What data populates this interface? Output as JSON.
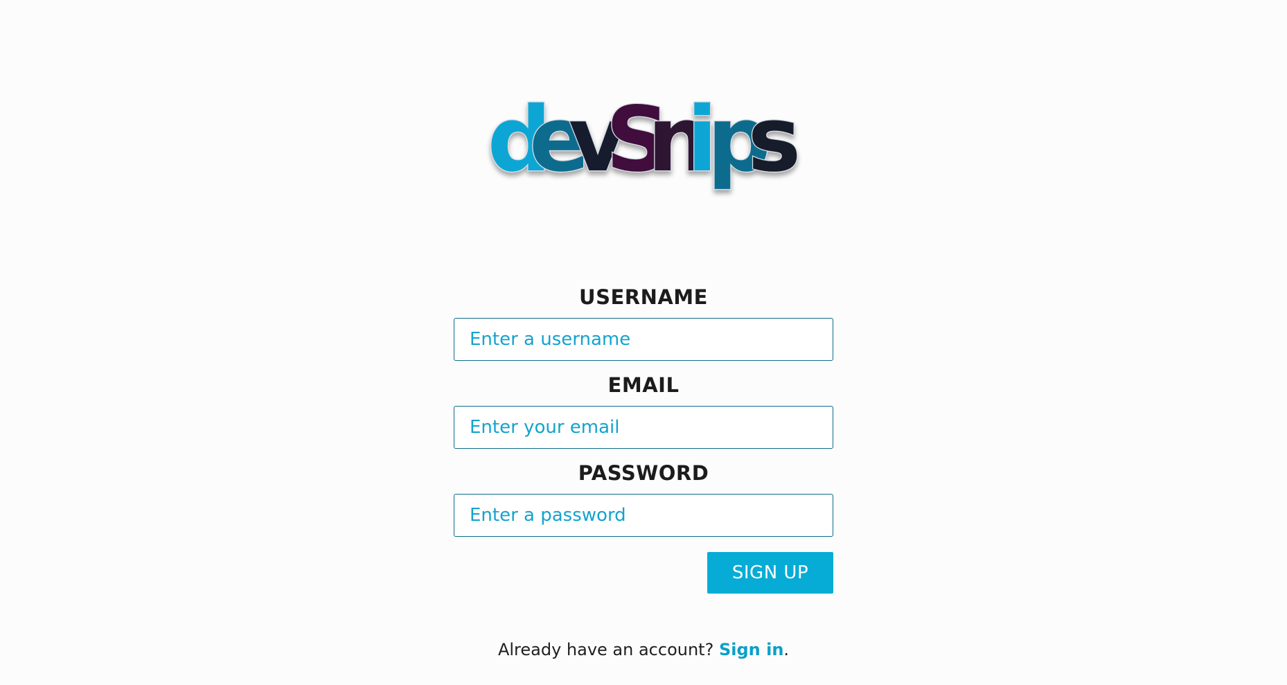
{
  "logo": {
    "letters": [
      "d",
      "e",
      "v",
      "S",
      "n",
      "i",
      "p",
      "s"
    ],
    "letter_colors": [
      "#0aa6d4",
      "#0b6c8e",
      "#161b2e",
      "#3f0f3d",
      "#2e1630",
      "#0aa6d4",
      "#0b6c8e",
      "#191a2c"
    ]
  },
  "form": {
    "username": {
      "label": "USERNAME",
      "placeholder": "Enter a username"
    },
    "email": {
      "label": "EMAIL",
      "placeholder": "Enter your email"
    },
    "password": {
      "label": "PASSWORD",
      "placeholder": "Enter a password"
    },
    "submit_label": "SIGN UP"
  },
  "footer": {
    "prompt": "Already have an account?",
    "link_label": "Sign in",
    "trailing": "."
  },
  "colors": {
    "accent": "#07acd6",
    "input_border": "#0e6b8a",
    "label_text": "#1c1c1c",
    "background": "#fcfcfc"
  }
}
